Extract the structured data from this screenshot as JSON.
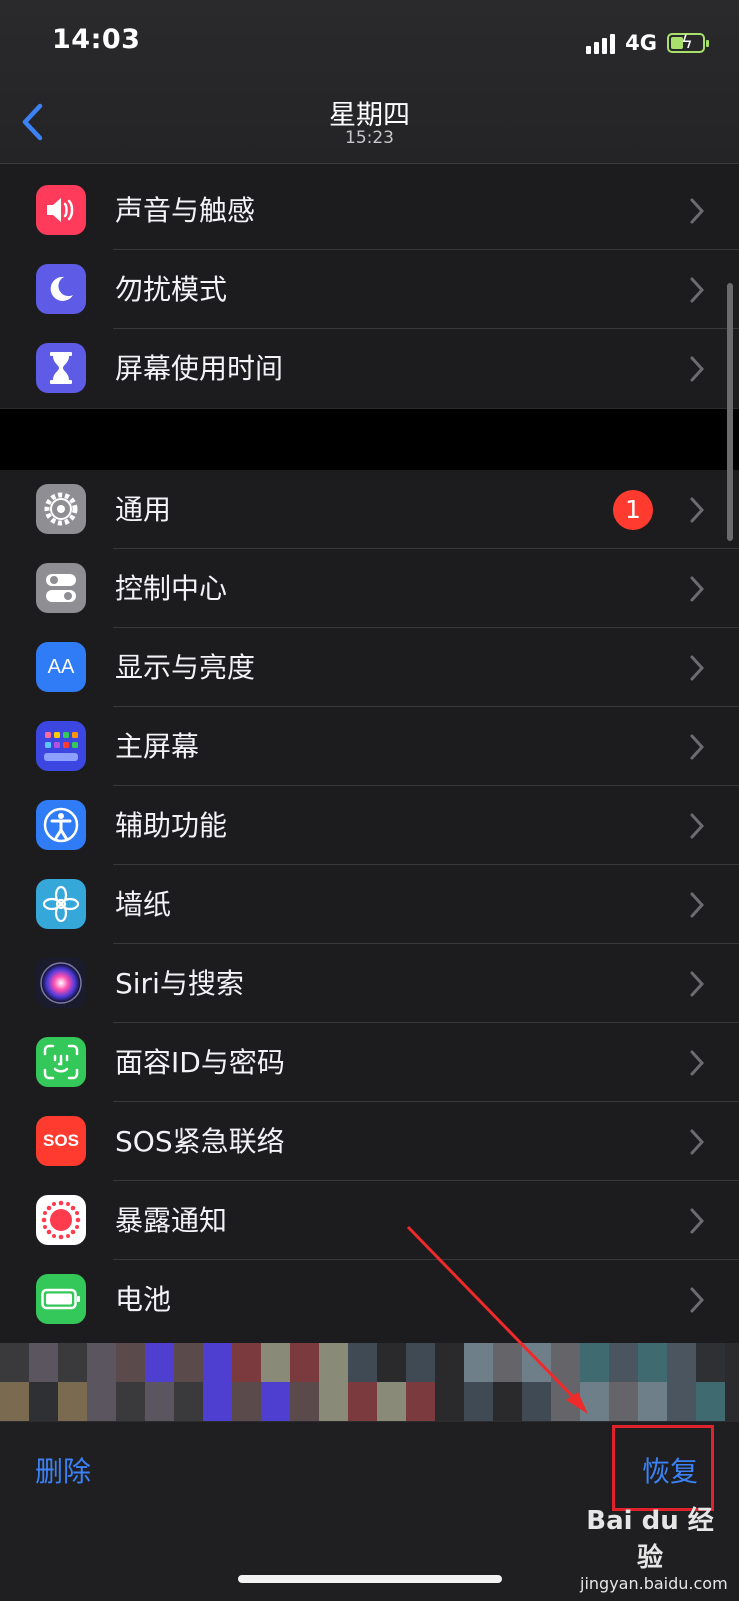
{
  "status_bar": {
    "time": "14:03",
    "network": "4G",
    "battery_color": "#a8e06b"
  },
  "nav": {
    "title": "星期四",
    "subtitle": "15:23",
    "back_icon": "chevron-left"
  },
  "group1": [
    {
      "label": "声音与触感",
      "icon": "speaker-icon",
      "color": "#ff3b5c"
    },
    {
      "label": "勿扰模式",
      "icon": "moon-icon",
      "color": "#5e5ce6"
    },
    {
      "label": "屏幕使用时间",
      "icon": "hourglass-icon",
      "color": "#5e5ce6"
    }
  ],
  "group2": [
    {
      "label": "通用",
      "icon": "gear-icon",
      "color": "#8e8e93",
      "badge": "1"
    },
    {
      "label": "控制中心",
      "icon": "toggles-icon",
      "color": "#8e8e93"
    },
    {
      "label": "显示与亮度",
      "icon": "text-size-icon",
      "color": "#2f7cf6",
      "glyph": "AA"
    },
    {
      "label": "主屏幕",
      "icon": "home-grid-icon",
      "color": "#3b47e0"
    },
    {
      "label": "辅助功能",
      "icon": "accessibility-icon",
      "color": "#2f7cf6"
    },
    {
      "label": "墙纸",
      "icon": "flower-icon",
      "color": "#35a7d8"
    },
    {
      "label": "Siri与搜索",
      "icon": "siri-icon",
      "color": "#1b1b2e"
    },
    {
      "label": "面容ID与密码",
      "icon": "face-id-icon",
      "color": "#34c759"
    },
    {
      "label": "SOS紧急联络",
      "icon": "sos-icon",
      "color": "#ff3b30",
      "glyph": "SOS"
    },
    {
      "label": "暴露通知",
      "icon": "exposure-icon",
      "color": "#ffffff"
    },
    {
      "label": "电池",
      "icon": "battery-icon",
      "color": "#34c759"
    }
  ],
  "bottom_bar": {
    "delete_label": "删除",
    "restore_label": "恢复"
  },
  "watermark": {
    "line1": "Bai du 经验",
    "line2": "jingyan.baidu.com"
  },
  "accent_color": "#3b82f6"
}
